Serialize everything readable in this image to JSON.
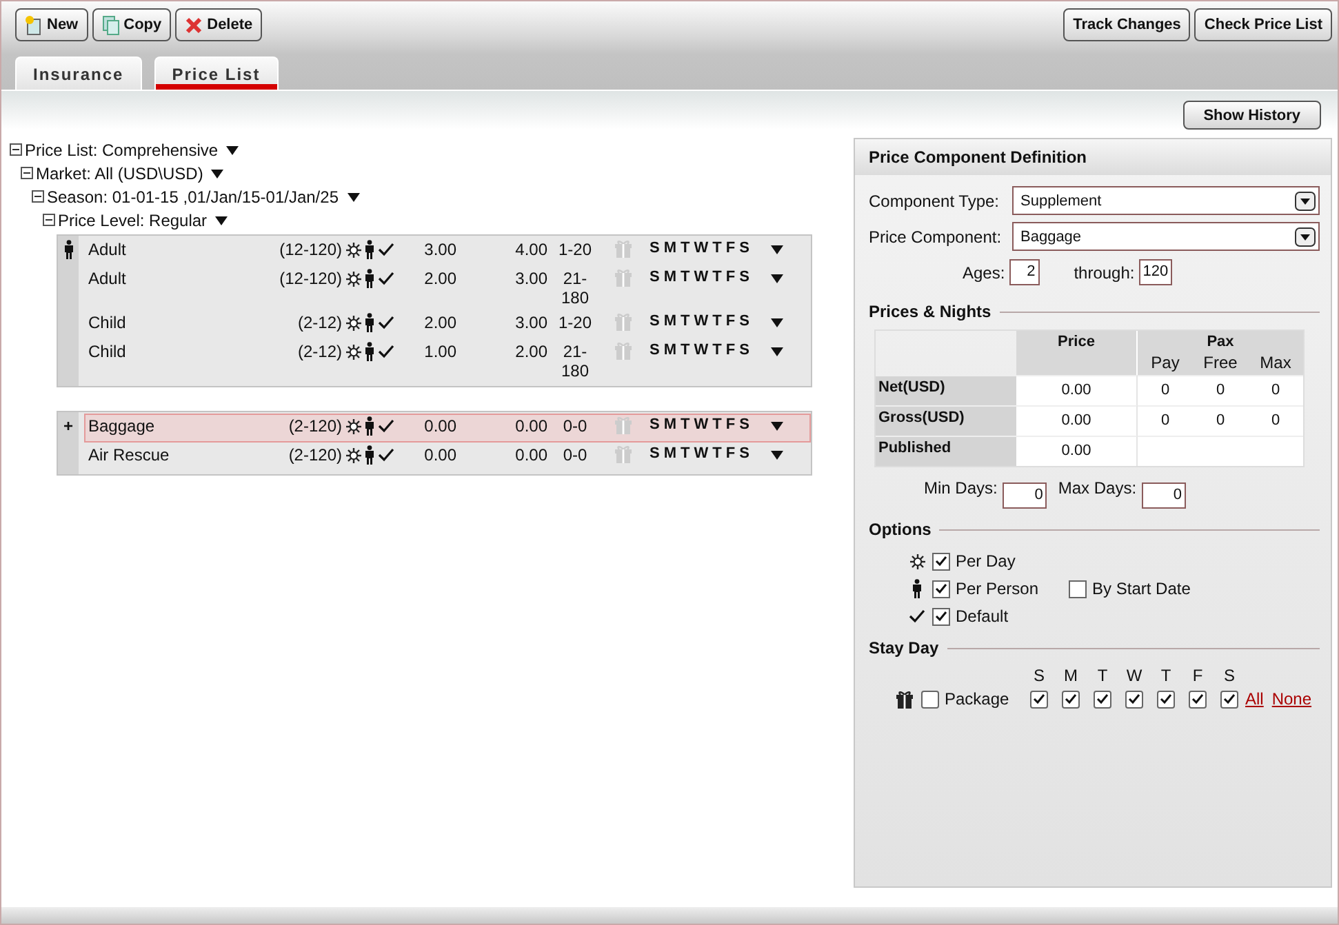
{
  "toolbar": {
    "left_buttons": [
      {
        "kind": "new",
        "label": "New"
      },
      {
        "kind": "copy",
        "label": "Copy"
      },
      {
        "kind": "delete",
        "label": "Delete"
      }
    ],
    "right_buttons": [
      {
        "label": "Track Changes"
      },
      {
        "label": "Check Price List"
      }
    ]
  },
  "tabs": [
    {
      "label": "Insurance",
      "selected": false
    },
    {
      "label": "Price List",
      "selected": true
    }
  ],
  "show_history": {
    "label": "Show History"
  },
  "tree": {
    "label": "Price List: Comprehensive",
    "expanded": true,
    "children": [
      {
        "label": "Market: All (USD\\USD)",
        "expanded": true,
        "children": [
          {
            "label": "Season: 01-01-15 ,01/Jan/15-01/Jan/25",
            "expanded": true,
            "children": [
              {
                "label": "Price Level: Regular",
                "expanded": true
              }
            ]
          }
        ]
      }
    ]
  },
  "groups": [
    {
      "kind": "person",
      "rows": [
        {
          "name": "Adult",
          "ages": "(12-120)",
          "net": "3.00",
          "gross": "4.00",
          "nights": "1-20",
          "days": [
            "S",
            "M",
            "T",
            "W",
            "T",
            "F",
            "S"
          ],
          "selected": false
        },
        {
          "name": "Adult",
          "ages": "(12-120)",
          "net": "2.00",
          "gross": "3.00",
          "nights": "21-180",
          "days": [
            "S",
            "M",
            "T",
            "W",
            "T",
            "F",
            "S"
          ],
          "selected": false
        },
        {
          "name": "Child",
          "ages": "(2-12)",
          "net": "2.00",
          "gross": "3.00",
          "nights": "1-20",
          "days": [
            "S",
            "M",
            "T",
            "W",
            "T",
            "F",
            "S"
          ],
          "selected": false
        },
        {
          "name": "Child",
          "ages": "(2-12)",
          "net": "1.00",
          "gross": "2.00",
          "nights": "21-180",
          "days": [
            "S",
            "M",
            "T",
            "W",
            "T",
            "F",
            "S"
          ],
          "selected": false
        }
      ]
    },
    {
      "kind": "text",
      "gutter": "+",
      "rows": [
        {
          "name": "Baggage",
          "ages": "(2-120)",
          "net": "0.00",
          "gross": "0.00",
          "nights": "0-0",
          "days": [
            "S",
            "M",
            "T",
            "W",
            "T",
            "F",
            "S"
          ],
          "selected": true
        },
        {
          "name": "Air Rescue",
          "ages": "(2-120)",
          "net": "0.00",
          "gross": "0.00",
          "nights": "0-0",
          "days": [
            "S",
            "M",
            "T",
            "W",
            "T",
            "F",
            "S"
          ],
          "selected": false
        }
      ]
    }
  ],
  "panel": {
    "title": "Price Component Definition",
    "component_type": {
      "label": "Component Type:",
      "value": "Supplement"
    },
    "price_component": {
      "label": "Price Component:",
      "value": "Baggage"
    },
    "ages": {
      "label": "Ages:",
      "value": "2"
    },
    "through": {
      "label": "through:",
      "value": "120"
    },
    "prices_title": "Prices & Nights",
    "price_header": "Price",
    "pax_header": "Pax",
    "pax_columns": [
      "Pay",
      "Free",
      "Max"
    ],
    "price_rows": [
      {
        "label": "Net(USD)",
        "price": "0.00",
        "pax": [
          "0",
          "0",
          "0"
        ]
      },
      {
        "label": "Gross(USD)",
        "price": "0.00",
        "pax": [
          "0",
          "0",
          "0"
        ]
      },
      {
        "label": "Published",
        "price": "0.00"
      }
    ],
    "min_days": {
      "label": "Min Days:",
      "value": "0"
    },
    "max_days": {
      "label": "Max Days:",
      "value": "0"
    },
    "options_title": "Options",
    "options": [
      {
        "kind": "sun",
        "label": "Per Day",
        "checked": true
      },
      {
        "kind": "person",
        "label": "Per Person",
        "checked": true,
        "extra": {
          "label": "By Start Date",
          "checked": false
        }
      },
      {
        "kind": "check",
        "label": "Default",
        "checked": true
      }
    ],
    "stay_title": "Stay Day",
    "package": {
      "label": "Package",
      "checked": false
    },
    "days": [
      {
        "label": "S",
        "checked": true
      },
      {
        "label": "M",
        "checked": true
      },
      {
        "label": "T",
        "checked": true
      },
      {
        "label": "W",
        "checked": true
      },
      {
        "label": "T",
        "checked": true
      },
      {
        "label": "F",
        "checked": true
      },
      {
        "label": "S",
        "checked": true
      }
    ],
    "links": [
      "All",
      "None"
    ]
  }
}
